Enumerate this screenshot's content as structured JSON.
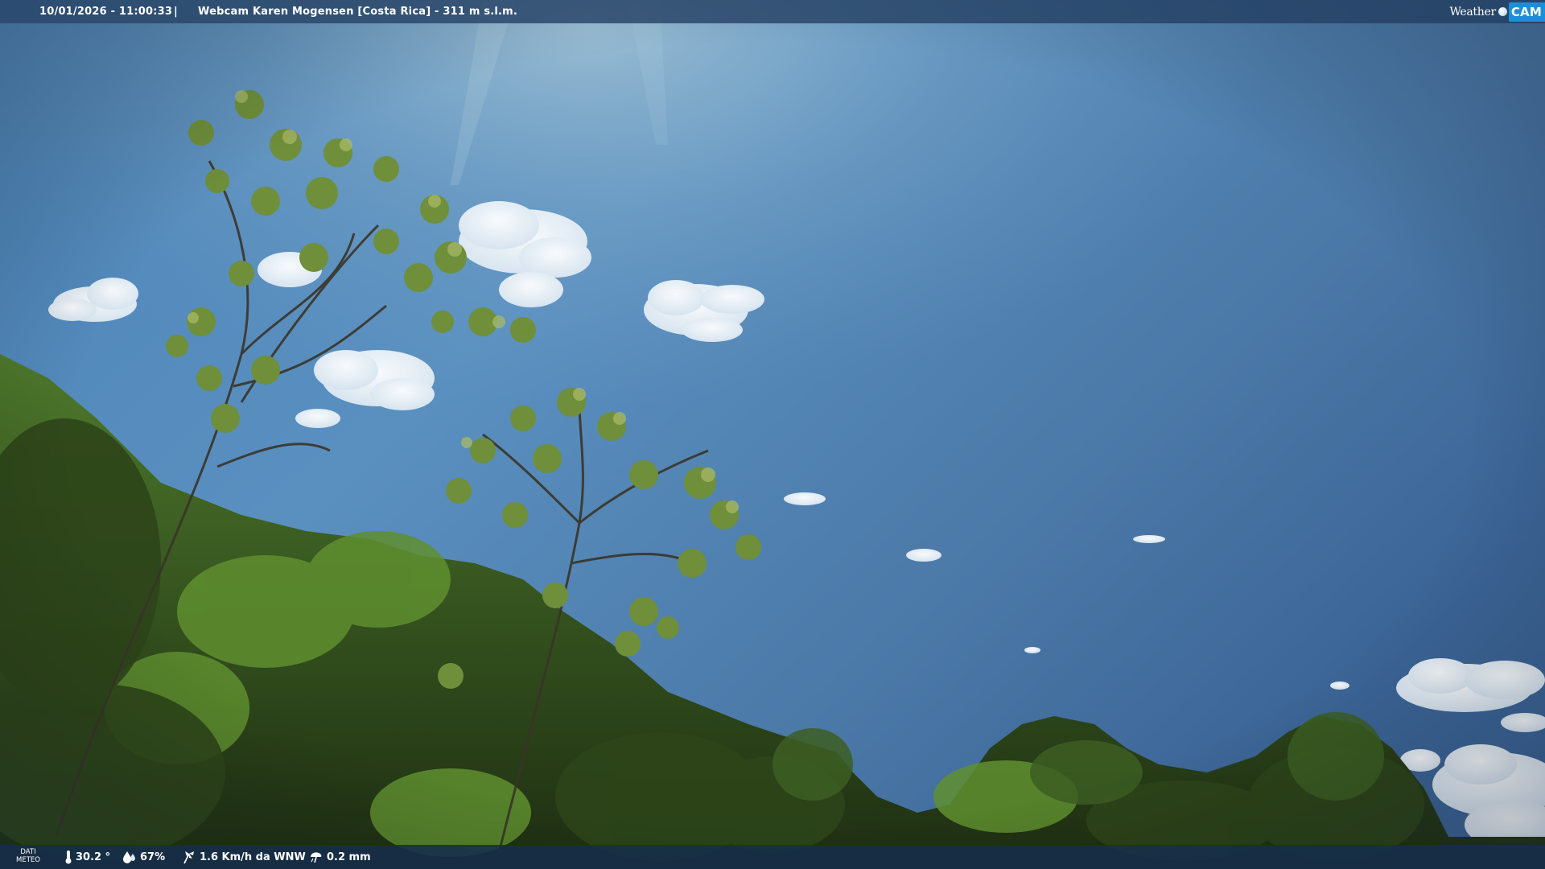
{
  "header": {
    "timestamp": "10/01/2026 - 11:00:33",
    "separator": "|",
    "title": "Webcam Karen Mogensen [Costa Rica] - 311 m s.l.m."
  },
  "brand": {
    "weather": "Weather",
    "cam": "CAM",
    "cam_color": "#1d8fd8"
  },
  "meteo": {
    "label_line1": "DATI",
    "label_line2": "METEO",
    "temperature": "30.2 °",
    "humidity": "67%",
    "wind": "1.6 Km/h da WNW",
    "rain": "0.2 mm"
  },
  "icons": {
    "temperature": "thermometer-icon",
    "humidity": "humidity-drop-icon",
    "wind": "wind-icon",
    "rain": "rain-icon"
  },
  "colors": {
    "sky_top": "#3f6ea3",
    "sky_mid": "#4f85b8",
    "foliage_dark": "#253818",
    "foliage_light": "#6e9a3a"
  }
}
